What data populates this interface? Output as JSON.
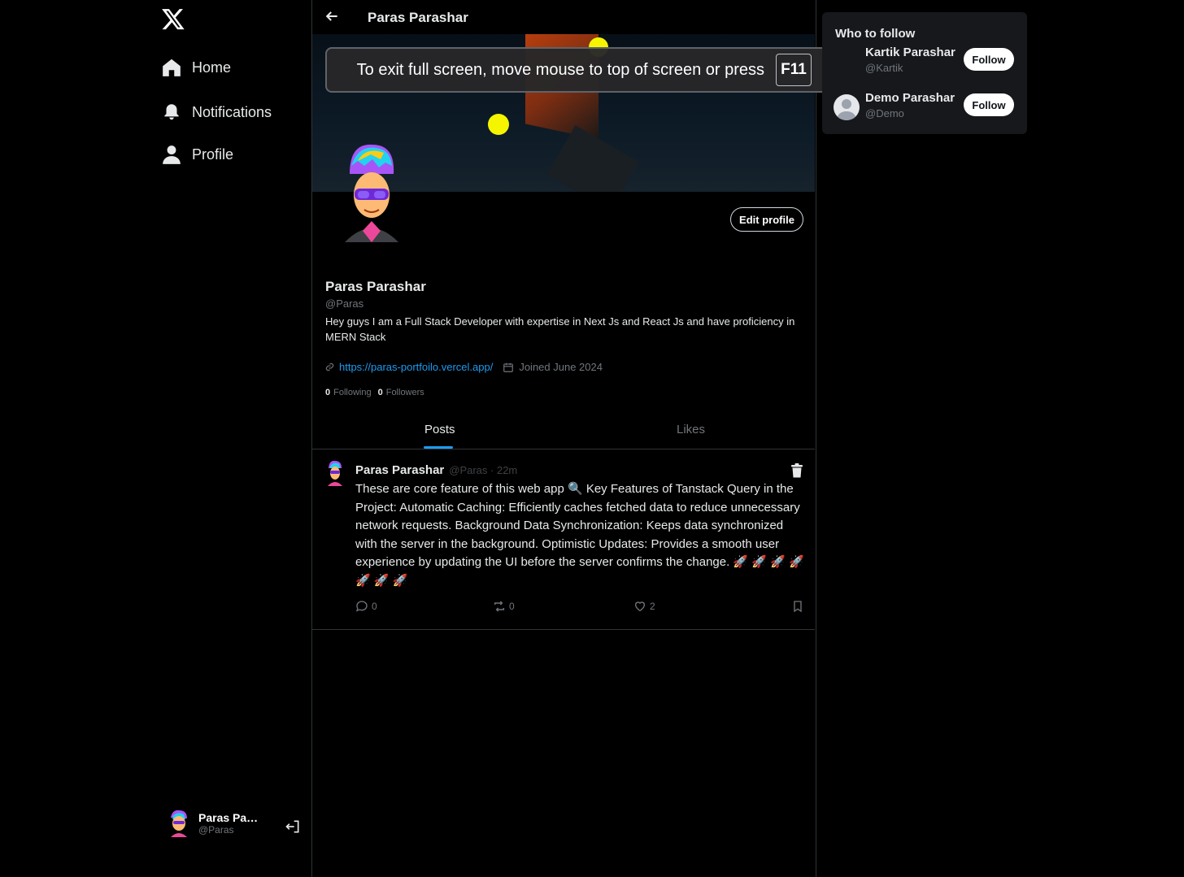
{
  "sidebar": {
    "logo": "x-logo",
    "items": [
      {
        "label": "Home",
        "icon": "home-icon"
      },
      {
        "label": "Notifications",
        "icon": "bell-icon"
      },
      {
        "label": "Profile",
        "icon": "user-icon"
      }
    ],
    "account": {
      "name": "Paras Par...",
      "handle": "@Paras"
    }
  },
  "header": {
    "title": "Paras Parashar"
  },
  "fullscreen_notice": {
    "message": "To exit full screen, move mouse to top of screen or press",
    "key": "F11"
  },
  "profile": {
    "edit_label": "Edit profile",
    "name": "Paras Parashar",
    "handle": "@Paras",
    "bio": "Hey guys I am a Full Stack Developer with expertise in Next Js and React Js and have proficiency in MERN Stack",
    "link": "https://paras-portfoilo.vercel.app/",
    "joined": "Joined June 2024",
    "following_count": "0",
    "following_label": "Following",
    "followers_count": "0",
    "followers_label": "Followers"
  },
  "tabs": [
    {
      "label": "Posts",
      "active": true
    },
    {
      "label": "Likes",
      "active": false
    }
  ],
  "post": {
    "author": "Paras Parashar",
    "meta": "@Paras · 22m",
    "text": "These are core feature of this web app 🔍 Key Features of Tanstack Query in the Project: Automatic Caching: Efficiently caches fetched data to reduce unnecessary network requests. Background Data Synchronization: Keeps data synchronized with the server in the background. Optimistic Updates: Provides a smooth user experience by updating the UI before the server confirms the change. 🚀 🚀 🚀 🚀 🚀 🚀 🚀",
    "comments": "0",
    "reposts": "0",
    "likes": "2"
  },
  "who_to_follow": {
    "title": "Who to follow",
    "users": [
      {
        "name": "Kartik Parashar",
        "handle": "@Kartik",
        "button": "Follow"
      },
      {
        "name": "Demo Parashar",
        "handle": "@Demo",
        "button": "Follow"
      }
    ]
  },
  "colors": {
    "accent": "#1d9bf0",
    "background": "#000000",
    "panel": "#16181c"
  }
}
